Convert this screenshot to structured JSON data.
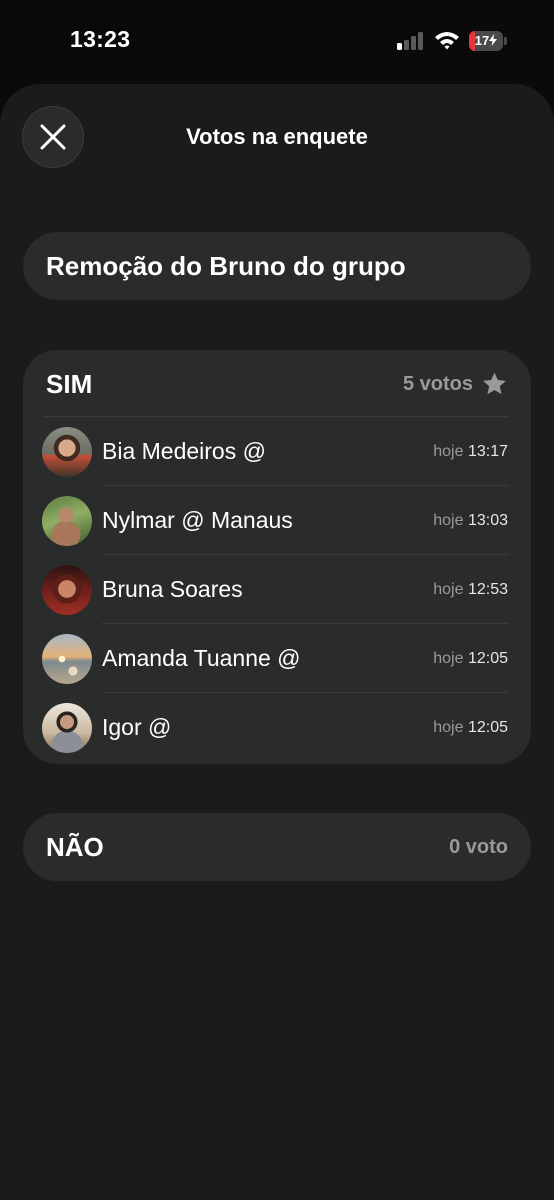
{
  "status_bar": {
    "time": "13:23",
    "battery_percent": "17",
    "battery_level": 0.17,
    "signal_bars_active": 1,
    "icons": [
      "signal-icon",
      "wifi-icon",
      "battery-icon",
      "charging-bolt-icon"
    ],
    "colors": {
      "battery_low": "#e5343a"
    }
  },
  "sheet": {
    "title": "Votos na enquete",
    "close_icon": "close-icon"
  },
  "poll": {
    "question": "Remoção do Bruno do grupo",
    "options": [
      {
        "name": "SIM",
        "count_label": "5 votos",
        "icon": "star-icon",
        "voters": [
          {
            "name": "Bia Medeiros @",
            "day": "hoje",
            "time": "13:17"
          },
          {
            "name": "Nylmar @ Manaus",
            "day": "hoje",
            "time": "13:03"
          },
          {
            "name": "Bruna Soares",
            "day": "hoje",
            "time": "12:53"
          },
          {
            "name": "Amanda Tuanne @",
            "day": "hoje",
            "time": "12:05"
          },
          {
            "name": "Igor @",
            "day": "hoje",
            "time": "12:05"
          }
        ]
      },
      {
        "name": "NÃO",
        "count_label": "0 voto",
        "voters": []
      }
    ]
  },
  "colors": {
    "background": "#0a0a0a",
    "sheet": "#1b1b1b",
    "card": "#2a2b2b",
    "muted_text": "#9a9a9a"
  }
}
